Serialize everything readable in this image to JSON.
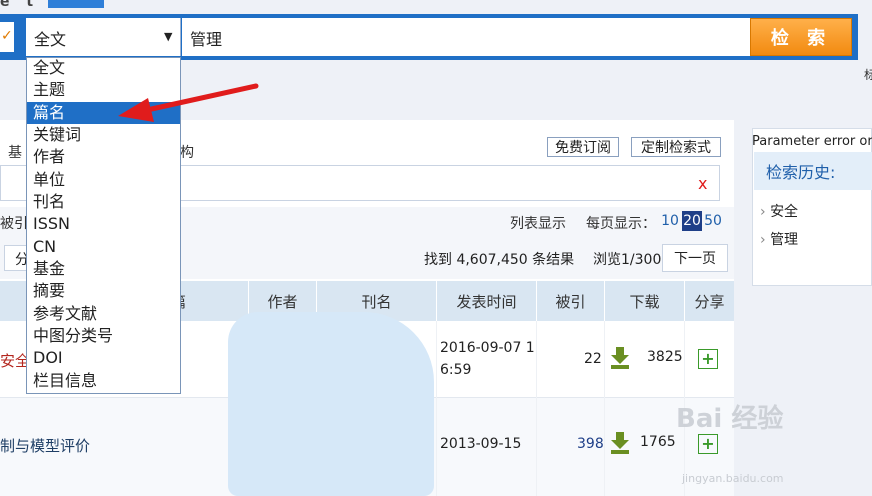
{
  "header": {
    "logo_fragment": "e t"
  },
  "search": {
    "field_selected": "全文",
    "query": "管理",
    "submit_label": "检 索"
  },
  "field_options": [
    "全文",
    "主题",
    "篇名",
    "关键词",
    "作者",
    "单位",
    "刊名",
    "ISSN",
    "CN",
    "基金",
    "摘要",
    "参考文献",
    "中图分类号",
    "DOI",
    "栏目信息"
  ],
  "field_highlighted_index": 2,
  "right_fragment": "标",
  "tabs": {
    "left_fragment": "基",
    "right_fragment": "构"
  },
  "actions": {
    "subscribe": "免费订阅",
    "custom_search": "定制检索式"
  },
  "filter": {
    "clear_symbol": "x"
  },
  "results_bar": {
    "cited_fragment": "被引",
    "list_view": "列表显示",
    "per_page_label": "每页显示：",
    "per_page_options": [
      "10",
      "20",
      "50"
    ],
    "per_page_selected": "20",
    "category_fragment": "分",
    "found_text": "找到 4,607,450 条结果",
    "browse_text": "浏览1/300",
    "next_page": "下一页"
  },
  "table": {
    "headers": {
      "title_fragment": "篇",
      "author": "作者",
      "journal": "刊名",
      "date": "发表时间",
      "cited": "被引",
      "download": "下载",
      "share": "分享"
    },
    "rows": [
      {
        "title_fragment": "安全",
        "date": "2016-09-07 1\n6:59",
        "date_line1": "2016-09-07 1",
        "date_line2": "6:59",
        "cited": "22",
        "downloads": "3825"
      },
      {
        "title_fragment": "制与模型评价",
        "date": "2013-09-15",
        "cited": "398",
        "downloads": "1765"
      }
    ]
  },
  "history": {
    "error_text": "Parameter error or",
    "title": "检索历史:",
    "items": [
      "安全",
      "管理"
    ]
  },
  "watermark": {
    "text": "Bai 经验",
    "sub": "jingyan.baidu.com"
  },
  "colors": {
    "accent_blue": "#1f6fc6",
    "search_button": "#f28a10",
    "arrow_red": "#e01c1c",
    "share_green": "#3a9a2a"
  }
}
